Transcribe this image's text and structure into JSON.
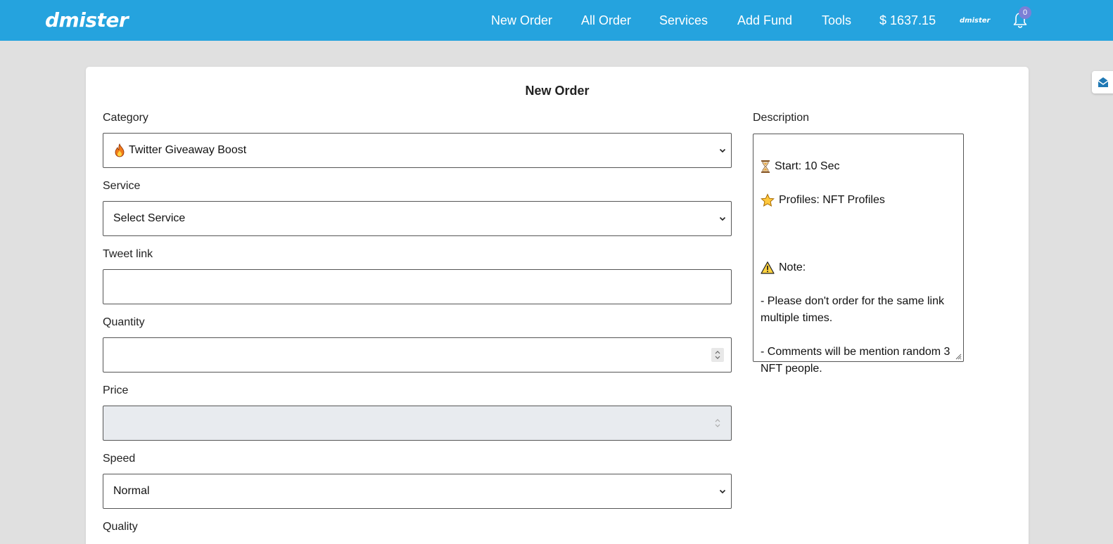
{
  "brand": {
    "logo_text": "dmister",
    "avatar_text": "dmister"
  },
  "nav": {
    "new_order": "New Order",
    "all_order": "All Order",
    "services": "Services",
    "add_fund": "Add Fund",
    "tools": "Tools",
    "balance": "$ 1637.15",
    "notification_count": "0"
  },
  "form": {
    "title": "New Order",
    "category": {
      "label": "Category",
      "value": "Twitter Giveaway Boost",
      "icon": "fire-icon"
    },
    "service": {
      "label": "Service",
      "value": "Select Service"
    },
    "tweet_link": {
      "label": "Tweet link",
      "value": ""
    },
    "quantity": {
      "label": "Quantity",
      "value": ""
    },
    "price": {
      "label": "Price",
      "value": ""
    },
    "speed": {
      "label": "Speed",
      "value": "Normal"
    },
    "quality": {
      "label": "Quality"
    }
  },
  "description": {
    "label": "Description",
    "start": "Start: 10 Sec",
    "profiles": "Profiles: NFT Profiles",
    "note_title": "Note:",
    "note_line1": "- Please don't order for the same link multiple times.",
    "note_line2": "- Comments will be mention random 3 NFT people."
  },
  "colors": {
    "topbar": "#25a3de",
    "badge": "#7b7fd6",
    "page_bg": "#e0e0e0"
  }
}
